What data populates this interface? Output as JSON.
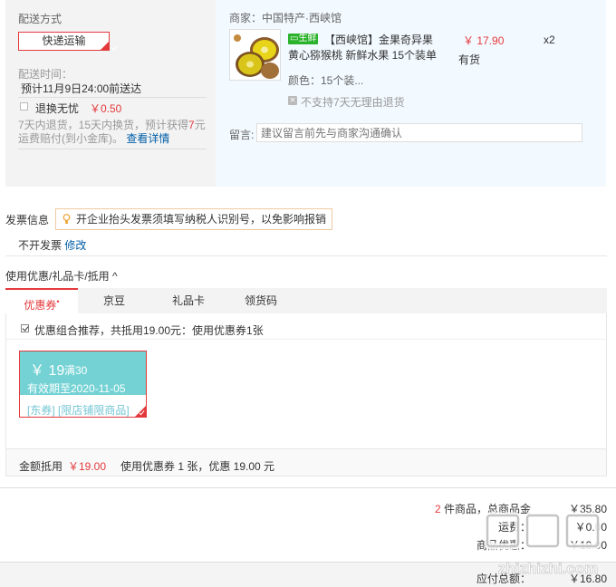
{
  "shipping": {
    "title": "配送方式",
    "method_button": "快递运输",
    "time_label": "配送时间：",
    "time_value": "预计11月9日24:00前送达",
    "return_label": "退换无忧",
    "return_price": "￥0.50",
    "return_desc_pre": "7天内退货，15天内换货，预计获得",
    "return_desc_num": "7",
    "return_desc_post": "元运费赔付(到小金库)。",
    "return_link": "查看详情"
  },
  "shop": {
    "label": "商家：中国特产·西峡馆",
    "fresh_badge": "生鲜",
    "product_title": "【西峡馆】金果奇异果 黄心猕猴桃 新鲜水果 15个装单",
    "price": "￥ 17.90",
    "qty": "x2",
    "stock": "有货",
    "color": "颜色：15个装...",
    "no_return": "不支持7天无理由退货",
    "message_label": "留言:",
    "message_placeholder": "建议留言前先与商家沟通确认"
  },
  "invoice": {
    "title": "发票信息",
    "tip": "开企业抬头发票须填写纳税人识别号，以免影响报销",
    "status": "不开发票",
    "edit_link": "修改"
  },
  "coupons": {
    "title": "使用优惠/礼品卡/抵用",
    "title_arrow": "^",
    "tabs": [
      {
        "label": "优惠券"
      },
      {
        "label": "京豆"
      },
      {
        "label": "礼品卡"
      },
      {
        "label": "领货码"
      }
    ],
    "active_star": "•",
    "combo_text": "优惠组合推荐，共抵用19.00元：使用优惠券1张",
    "card": {
      "amount": "￥ 19",
      "condition": "满30",
      "expiry": "有效期至2020-11-05",
      "tags": "[东券]  [限店铺限商品]"
    },
    "summary_label": "金额抵用",
    "summary_amount": "￥19.00",
    "summary_desc": "使用优惠券 1 张，优惠 19.00 元"
  },
  "totals": {
    "count": "2",
    "count_label": "件商品，总商品金",
    "goods_amount": "￥35.80",
    "row2_label": "运费：",
    "row2_value": "￥0.00",
    "row3_label": "商品优惠：",
    "row3_value": "-￥19.00",
    "payable_label": "应付总额：",
    "payable_value": "￥16.80"
  },
  "watermark": {
    "brand": "值值值",
    "url": "zhizhizhi.com"
  },
  "colors": {
    "accent": "#e4393c",
    "coupon": "#74d2d4",
    "link": "#005ea7"
  }
}
